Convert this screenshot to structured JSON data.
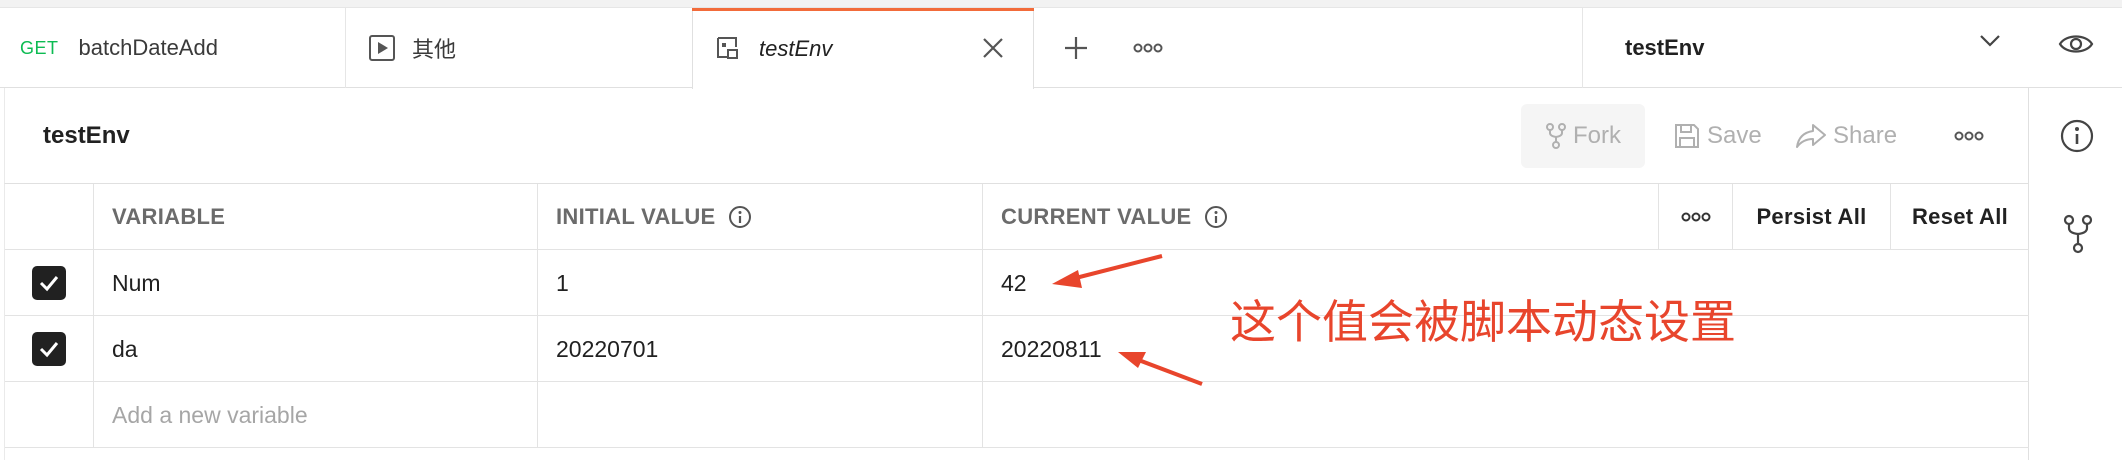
{
  "tabs": [
    {
      "method": "GET",
      "label": "batchDateAdd"
    },
    {
      "label": "其他",
      "icon": "play-icon"
    },
    {
      "label": "testEnv",
      "icon": "environment-icon",
      "active": true
    }
  ],
  "environment_selector": {
    "value": "testEnv"
  },
  "header": {
    "title": "testEnv",
    "fork_label": "Fork",
    "save_label": "Save",
    "share_label": "Share"
  },
  "table": {
    "columns": [
      "VARIABLE",
      "INITIAL VALUE",
      "CURRENT VALUE"
    ],
    "persist_all_label": "Persist All",
    "reset_all_label": "Reset All",
    "rows": [
      {
        "enabled": true,
        "variable": "Num",
        "initial": "1",
        "current": "42"
      },
      {
        "enabled": true,
        "variable": "da",
        "initial": "20220701",
        "current": "20220811"
      }
    ],
    "new_variable_placeholder": "Add a new variable"
  },
  "annotation": {
    "text": "这个值会被脚本动态设置",
    "color": "#e8452c"
  },
  "colors": {
    "accent": "#f26b3a",
    "get_method": "#0cbb52",
    "disabled_text": "#b0b0b0"
  }
}
